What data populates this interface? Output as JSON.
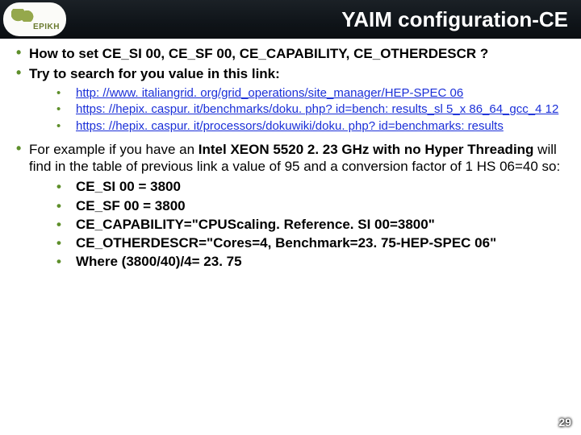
{
  "header": {
    "logo_text": "EPIKH",
    "title": "YAIM configuration-CE"
  },
  "bullets": {
    "b1": "How to set CE_SI 00, CE_SF 00, CE_CAPABILITY, CE_OTHERDESCR ?",
    "b2": "Try to search for you value in this link:",
    "links": [
      "http: //www. italiangrid. org/grid_operations/site_manager/HEP-SPEC 06",
      "https: //hepix. caspur. it/benchmarks/doku. php? id=bench: results_sl 5_x 86_64_gcc_4 12",
      "https: //hepix. caspur. it/processors/dokuwiki/doku. php? id=benchmarks: results"
    ],
    "b3_pre": "For example if you have an ",
    "b3_strong": "Intel XEON 5520 2. 23 GHz with no Hyper Threading",
    "b3_post": " will find in the table of previous link a value of 95 and a conversion factor of 1 HS 06=40 so:",
    "values": [
      "CE_SI 00 = 3800",
      "CE_SF 00 = 3800",
      "CE_CAPABILITY=\"CPUScaling. Reference. SI 00=3800\"",
      "CE_OTHERDESCR=\"Cores=4, Benchmark=23. 75-HEP-SPEC 06\"",
      "Where (3800/40)/4= 23. 75"
    ]
  },
  "page_number": "29"
}
